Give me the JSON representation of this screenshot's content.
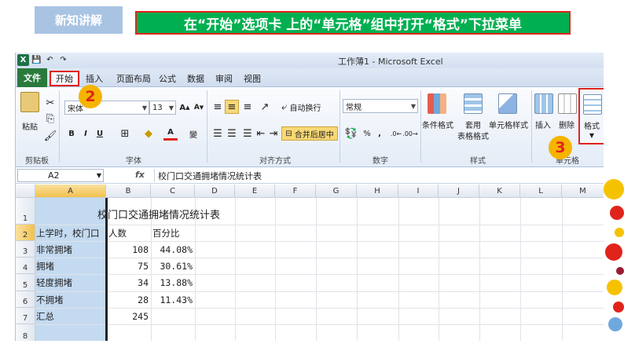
{
  "slide": {
    "tag": "新知讲解",
    "title": "在“开始”选项卡 上的“单元格”组中打开“格式”下拉菜单"
  },
  "window": {
    "title": "工作薄1 - Microsoft Excel"
  },
  "tabs": [
    "文件",
    "开始",
    "插入",
    "页面布局",
    "公式",
    "数据",
    "审阅",
    "视图"
  ],
  "ribbon": {
    "clipboard": {
      "paste": "粘贴",
      "label": "剪贴板"
    },
    "font": {
      "name": "宋体",
      "size": "13",
      "bold": "B",
      "italic": "I",
      "underline": "U",
      "wen": "變",
      "label": "字体"
    },
    "alignment": {
      "wrap": "自动换行",
      "merge": "合并后居中",
      "label": "对齐方式"
    },
    "number": {
      "format": "常规",
      "percent": "%",
      "comma": ",",
      "label": "数字"
    },
    "styles": {
      "conditional": "条件格式",
      "table1": "套用",
      "table2": "表格格式",
      "cellstyle": "单元格样式",
      "label": "样式"
    },
    "cells": {
      "insert": "插入",
      "delete": "删除",
      "format": "格式",
      "label": "单元格"
    }
  },
  "badges": [
    "2",
    "3"
  ],
  "formula_bar": {
    "name_box": "A2",
    "fx": "fx",
    "content": "校门口交通拥堵情况统计表"
  },
  "columns": [
    "A",
    "B",
    "C",
    "D",
    "E",
    "F",
    "G",
    "H",
    "I",
    "J",
    "K",
    "L",
    "M"
  ],
  "rows": [
    "1",
    "2",
    "3",
    "4",
    "5",
    "6",
    "7",
    "8"
  ],
  "sheet": {
    "title": "校门口交通拥堵情况统计表",
    "header": [
      "上学时，校门口",
      "人数",
      "百分比"
    ],
    "data": [
      [
        "非常拥堵",
        "108",
        "44.08%"
      ],
      [
        "拥堵",
        "75",
        "30.61%"
      ],
      [
        "轻度拥堵",
        "34",
        "13.88%"
      ],
      [
        "不拥堵",
        "28",
        "11.43%"
      ],
      [
        "汇总",
        "245",
        ""
      ]
    ]
  },
  "colors": {
    "accent_green": "#00b050",
    "highlight_red": "#e0241b",
    "badge_yellow": "#f5b400",
    "file_tab": "#2a7a3c"
  }
}
